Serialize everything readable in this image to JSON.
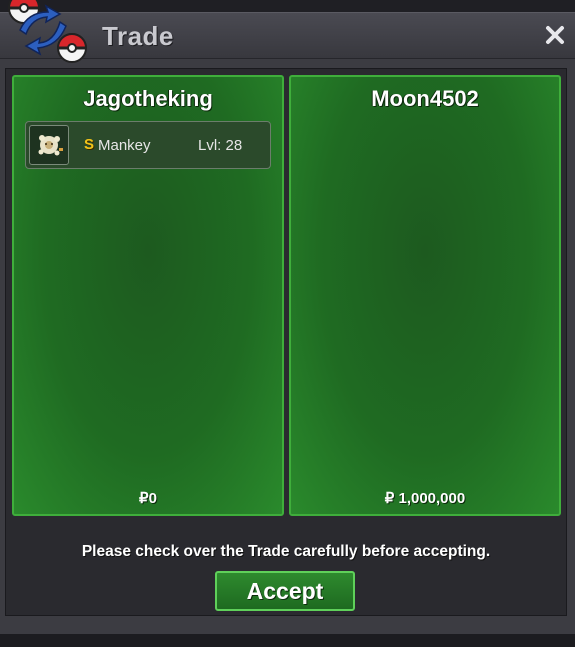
{
  "window": {
    "title": "Trade",
    "close_icon": "close-icon",
    "logo_icon": "trade-swap-pokeballs-icon"
  },
  "left_panel": {
    "player_name": "Jagotheking",
    "items": [
      {
        "icon": "mankey-sprite-icon",
        "shiny_marker": "S",
        "name": "Mankey",
        "level": "Lvl: 28"
      }
    ],
    "money": "₽0"
  },
  "right_panel": {
    "player_name": "Moon4502",
    "items": [],
    "money": "₽ 1,000,000"
  },
  "notice": "Please check over the Trade carefully before accepting.",
  "accept_button": "Accept",
  "colors": {
    "panel_green": "#1f6b22",
    "panel_border": "#3fae3b",
    "shiny_gold": "#f2c31a",
    "window_bg": "#3c3c42"
  }
}
